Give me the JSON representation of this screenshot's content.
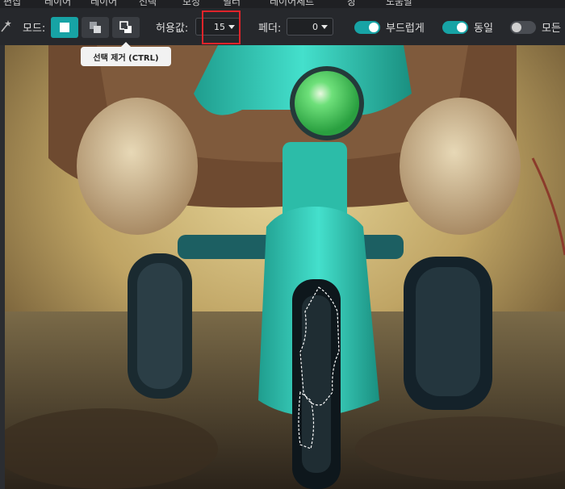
{
  "menu": {
    "items": [
      "편집",
      "레이어",
      "레이어",
      "선택",
      "보정",
      "필터",
      "레이어세트",
      "창",
      "도움말"
    ]
  },
  "toolbar": {
    "mode_label": "모드:",
    "modes": [
      {
        "name": "new-selection",
        "active": true
      },
      {
        "name": "add-selection",
        "active": false
      },
      {
        "name": "subtract-selection",
        "active": false
      }
    ],
    "tolerance_label": "허용값:",
    "tolerance_value": "15",
    "feather_label": "페더:",
    "feather_value": "0",
    "toggles": [
      {
        "label": "부드럽게",
        "on": true
      },
      {
        "label": "동일",
        "on": true
      },
      {
        "label": "모든",
        "on": false
      }
    ]
  },
  "tooltip": {
    "text": "선택 제거 (CTRL)"
  },
  "colors": {
    "accent": "#17a3a5",
    "highlight_box": "#e0242a",
    "toolbar_bg": "#26282c"
  },
  "icons": [
    "magic-wand-icon",
    "new-selection-icon",
    "add-selection-icon",
    "subtract-selection-icon"
  ]
}
